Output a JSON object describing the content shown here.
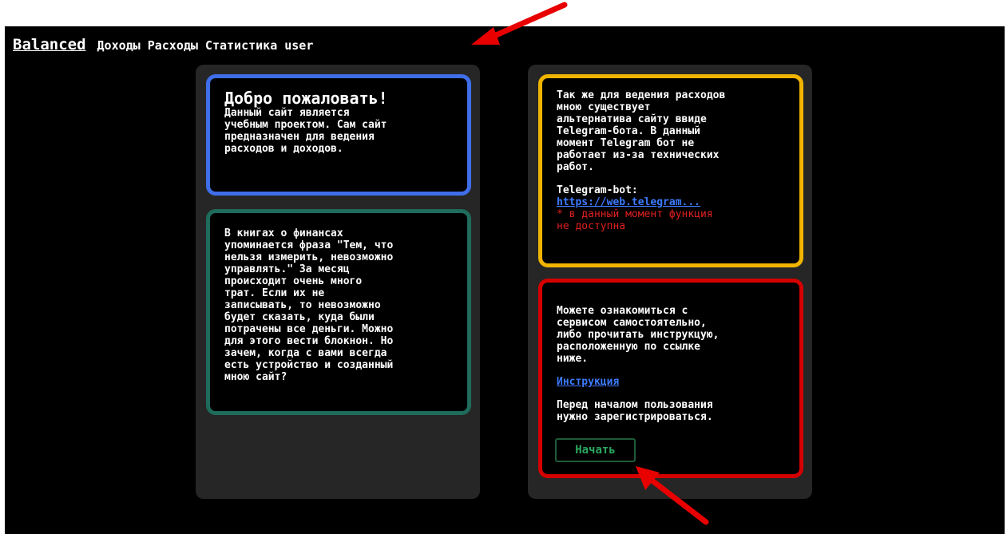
{
  "nav": {
    "brand": "Balanced",
    "links": [
      "Доходы",
      "Расходы",
      "Статистика",
      "user"
    ]
  },
  "welcome": {
    "title": "Добро пожаловать!",
    "text": "Данный сайт является\nучебным проектом. Сам сайт\nпредназначен для ведения\nрасходов и доходов."
  },
  "finance": {
    "text": "В книгах о финансах\nупоминается фраза \"Тем, что\nнельзя измерить, невозможно\nуправлять.\" За месяц\nпроисходит очень много\nтрат. Если их не\nзаписывать, то невозможно\nбудет сказать, куда были\nпотрачены все деньги. Можно\nдля этого вести блокнон. Но\nзачем, когда с вами всегда\nесть устройство и созданный\nмною сайт?"
  },
  "telegram": {
    "text": "Так же для ведения расходов\nмною существует\nальтернатива сайту ввиде\nTelegram-бота. В данный\nмомент Telegram бот не\nработает из-за технических\nработ.",
    "label": "Telegram-bot:",
    "link": "https://web.telegram...",
    "warning": "* в данный момент функция\nне доступна"
  },
  "intro": {
    "text": "Можете ознакомиться с\nсервисом самостоятельно,\nлибо прочитать инструкцую,\nрасположенную по ссылке\nниже.",
    "link": "Инструкция",
    "note": "Перед началом пользования\nнужно зарегистрироваться.",
    "button": "Начать"
  },
  "colors": {
    "background": "#000000",
    "column": "#262626",
    "blue": "#3f6ee8",
    "green": "#1f6b5c",
    "yellow": "#f0b400",
    "red": "#d40000",
    "link": "#3d7bff",
    "annotation_arrow": "#e80000"
  },
  "icons": [
    "arrow-annotation-icon"
  ]
}
